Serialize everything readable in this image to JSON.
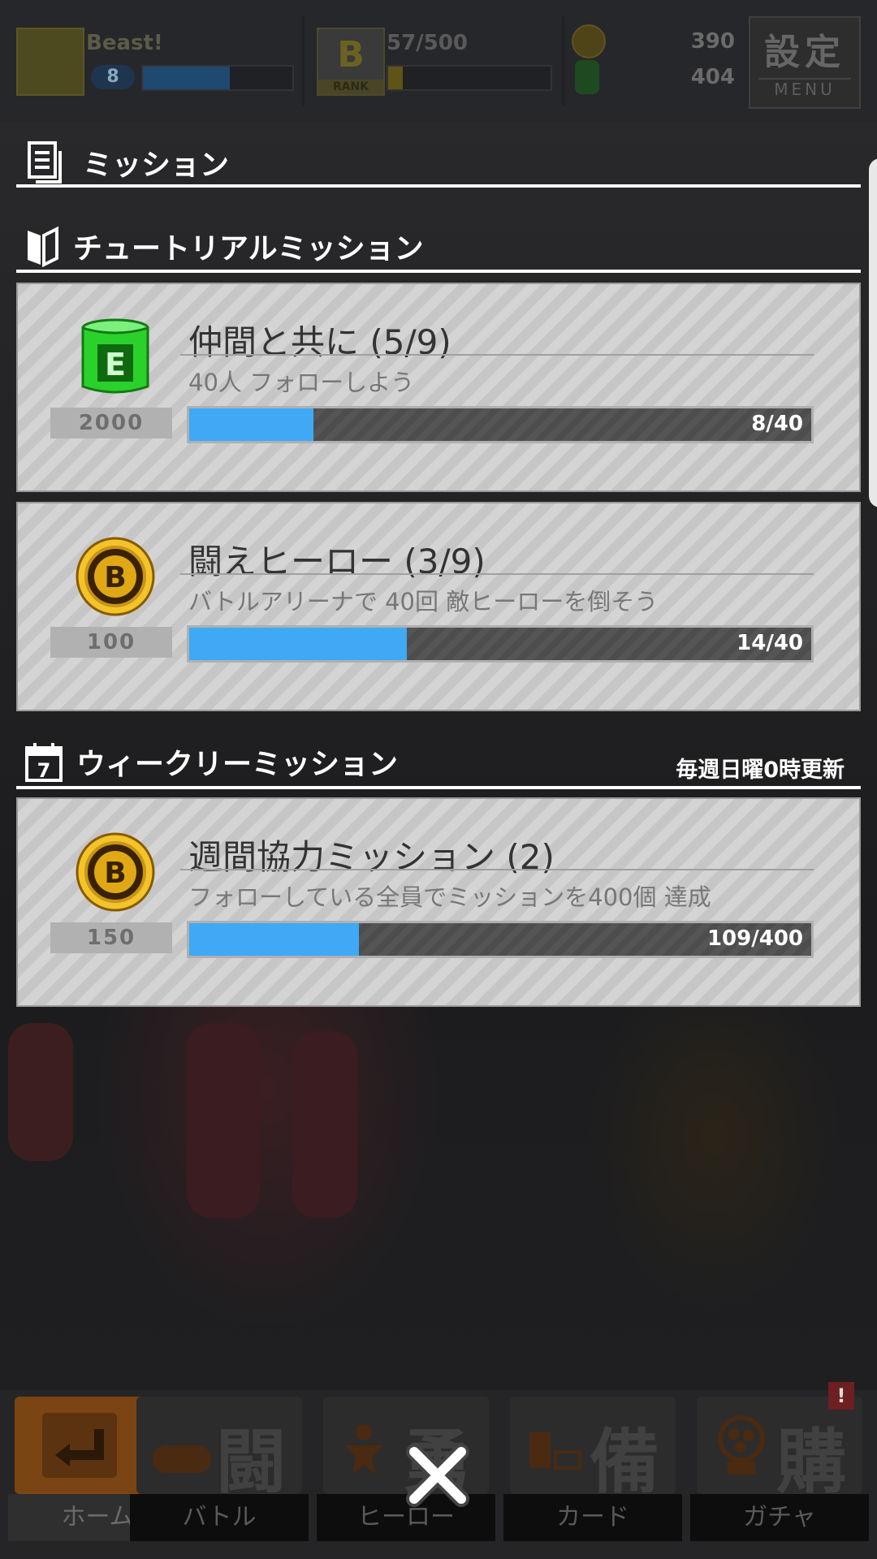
{
  "header": {
    "player_name": "Beast!",
    "level": "8",
    "rank_progress": "57/500",
    "rank_label": "RANK",
    "coins": "390",
    "barrels": "404",
    "menu_kanji": "設定",
    "menu_label": "MENU",
    "xp_fraction": 0.58,
    "rank_fraction": 0.09
  },
  "panel": {
    "title": "ミッション",
    "tutorial_heading": "チュートリアルミッション",
    "weekly_heading": "ウィークリーミッション",
    "weekly_note": "毎週日曜0時更新"
  },
  "missions": [
    {
      "title": "仲間と共に (5/9)",
      "desc": "40人 フォローしよう",
      "reward": "2000",
      "progress": "8/40",
      "fraction": 0.2,
      "reward_icon": "barrel-icon"
    },
    {
      "title": "闘えヒーロー (3/9)",
      "desc": "バトルアリーナで 40回 敵ヒーローを倒そう",
      "reward": "100",
      "progress": "14/40",
      "fraction": 0.35,
      "reward_icon": "coin-icon"
    },
    {
      "title": "週間協力ミッション (2)",
      "desc": "フォローしている全員でミッションを400個 達成",
      "reward": "150",
      "progress": "109/400",
      "fraction": 0.2725,
      "reward_icon": "coin-icon"
    }
  ],
  "nav": {
    "home": "ホーム",
    "battle": "バトル",
    "battle_glyph": "闘",
    "hero": "ヒーロー",
    "hero_glyph": "勇",
    "card": "カード",
    "card_glyph": "備",
    "gacha": "ガチャ",
    "gacha_glyph": "購",
    "alert": "!"
  },
  "colors": {
    "progress_fill": "#3fa9f5",
    "coin": "#e0a814",
    "barrel": "#2bd12b"
  }
}
